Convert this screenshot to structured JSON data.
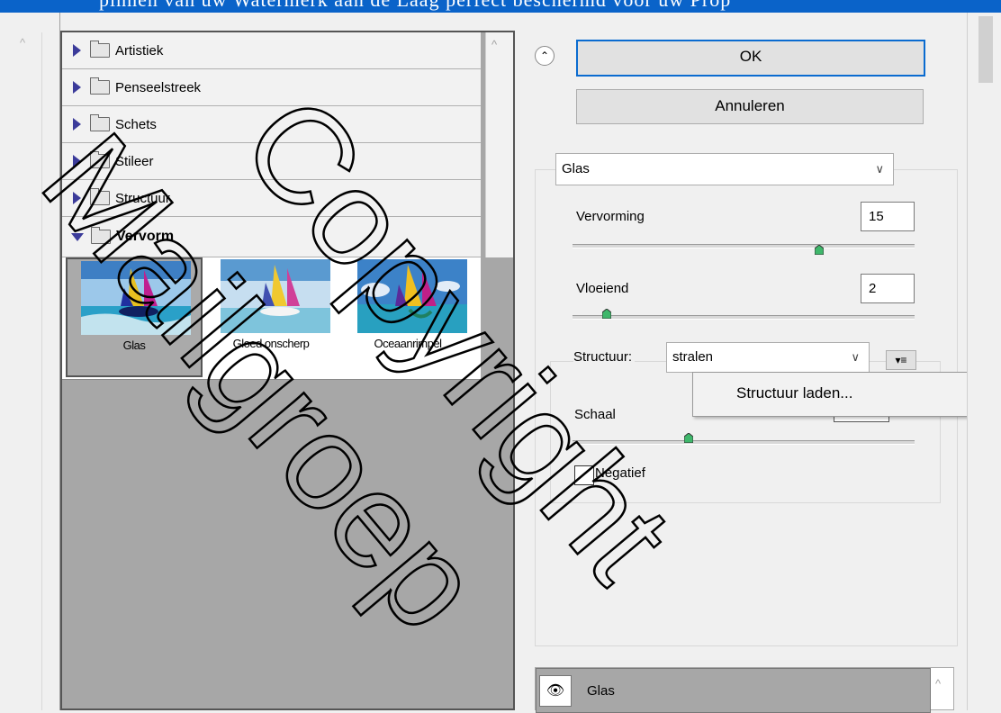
{
  "top_strip_text": "pinnen van uw Watermerk aan de Laag perfect beschermd voor uw Prop",
  "categories": [
    {
      "label": "Artistiek",
      "expanded": false
    },
    {
      "label": "Penseelstreek",
      "expanded": false
    },
    {
      "label": "Schets",
      "expanded": false
    },
    {
      "label": "Stileer",
      "expanded": false
    },
    {
      "label": "Structuur",
      "expanded": false
    },
    {
      "label": "Vervorm",
      "expanded": true
    }
  ],
  "thumbnails": [
    {
      "label": "Glas",
      "selected": true
    },
    {
      "label": "Gloed onscherp",
      "selected": false
    },
    {
      "label": "Oceaanrimpel",
      "selected": false
    }
  ],
  "buttons": {
    "ok": "OK",
    "cancel": "Annuleren"
  },
  "filter_select": "Glas",
  "params": {
    "vervorming": {
      "label": "Vervorming",
      "value": "15",
      "slider_fraction": 0.72
    },
    "vloeiend": {
      "label": "Vloeiend",
      "value": "2",
      "slider_fraction": 0.1
    },
    "structuur": {
      "label": "Structuur:",
      "value": "stralen"
    },
    "schaal": {
      "label": "Schaal",
      "slider_fraction": 0.34,
      "unit": "%"
    },
    "negatief": {
      "label": "Negatief",
      "checked": false
    }
  },
  "context_menu_item": "Structuur laden...",
  "layer": {
    "label": "Glas"
  },
  "watermark": [
    "Copyright",
    "Mailgroep"
  ],
  "colors": {
    "accent": "#0a63c9",
    "ok_border": "#0a6bd0",
    "triangle": "#3b3b9a",
    "watermark": "#000000"
  },
  "icons": {
    "expand": "chevron-up-icon",
    "collapse": "double-chevron-up-icon",
    "visibility": "eye-icon",
    "menu": "panel-menu-icon"
  }
}
